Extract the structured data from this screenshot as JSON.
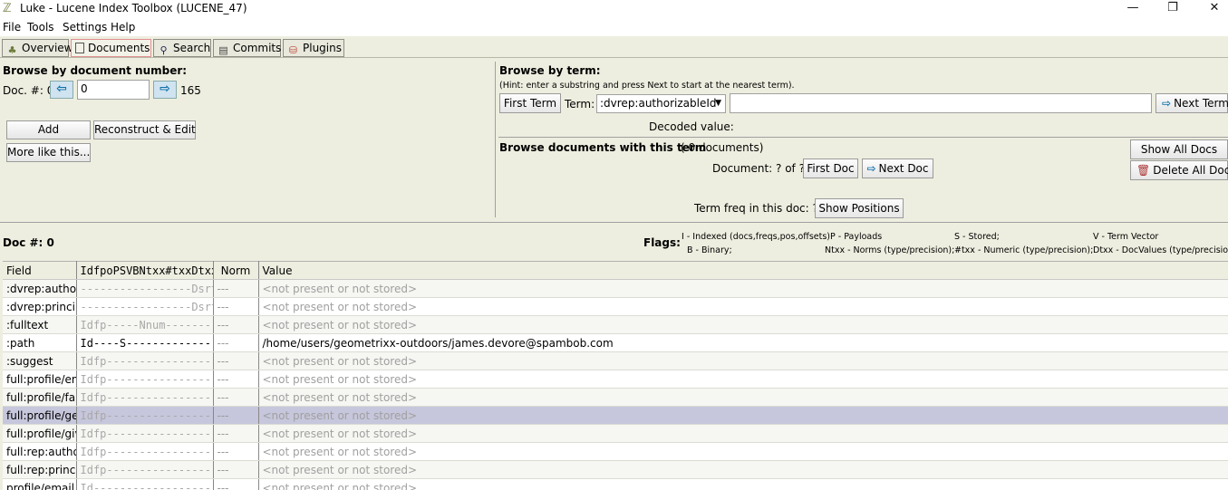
{
  "window": {
    "title": "Luke - Lucene Index Toolbox (LUCENE_47)",
    "min": "—",
    "max": "❐",
    "close": "✕"
  },
  "menu": [
    "File",
    "Tools",
    "Settings",
    "Help"
  ],
  "tabs": [
    {
      "label": "Overview",
      "icon": "tree-icon"
    },
    {
      "label": "Documents",
      "icon": "document-icon"
    },
    {
      "label": "Search",
      "icon": "search-icon"
    },
    {
      "label": "Commits",
      "icon": "commits-icon"
    },
    {
      "label": "Plugins",
      "icon": "plugins-icon"
    }
  ],
  "browse_doc": {
    "heading": "Browse by document number:",
    "doc_label": "Doc. #: 0",
    "doc_value": "0",
    "max_doc": "165",
    "add": "Add",
    "reconstruct": "Reconstruct & Edit",
    "more_like": "More like this..."
  },
  "browse_term": {
    "heading": "Browse by term:",
    "hint": "(Hint: enter a substring and press Next to start at the nearest term).",
    "first_term": "First Term",
    "term_label": "Term:",
    "term_field": ":dvrep:authorizableId",
    "term_value": "",
    "next_term": "Next Term",
    "decoded_label": "Decoded value:"
  },
  "browse_docs_term": {
    "heading": "Browse documents with this term",
    "count": "( 0  documents)",
    "doc_pos": "Document: ?  of  ?",
    "first_doc": "First Doc",
    "next_doc": "Next Doc",
    "show_all": "Show All Docs",
    "delete_all": "Delete All Docs",
    "term_freq": "Term freq in this doc:  ?",
    "show_positions": "Show Positions"
  },
  "doc_info": {
    "label": "Doc #: 0",
    "flags_label": "Flags:",
    "flags": [
      "I - Indexed (docs,freqs,pos,offsets)",
      "P - Payloads",
      "S - Stored;",
      "V - Term Vector",
      "B - Binary;",
      "Ntxx - Norms (type/precision);",
      "#txx - Numeric (type/precision);",
      "Dtxx - DocValues (type/precision)"
    ]
  },
  "table": {
    "headers": [
      "Field",
      "IdfpoPSVBNtxx#txxDtxx",
      "Norm",
      "Value"
    ],
    "rows": [
      {
        "field": ":dvrep:author",
        "flags": "-----------------Dsrt",
        "norm": "---",
        "value": "<not present or not stored>"
      },
      {
        "field": ":dvrep:princip",
        "flags": "-----------------Dsrt",
        "norm": "---",
        "value": "<not present or not stored>"
      },
      {
        "field": ":fulltext",
        "flags": "Idfp-----Nnum--------",
        "norm": "---",
        "value": "<not present or not stored>"
      },
      {
        "field": ":path",
        "flags": "Id----S--------------",
        "norm": "---",
        "value": "/home/users/geometrixx-outdoors/james.devore@spambob.com"
      },
      {
        "field": ":suggest",
        "flags": "Idfp-----------------",
        "norm": "---",
        "value": "<not present or not stored>"
      },
      {
        "field": "full:profile/em",
        "flags": "Idfp-----------------",
        "norm": "---",
        "value": "<not present or not stored>"
      },
      {
        "field": "full:profile/fan",
        "flags": "Idfp-----------------",
        "norm": "---",
        "value": "<not present or not stored>"
      },
      {
        "field": "full:profile/ge",
        "flags": "Idfp-----------------",
        "norm": "---",
        "value": "<not present or not stored>"
      },
      {
        "field": "full:profile/giv",
        "flags": "Idfp-----------------",
        "norm": "---",
        "value": "<not present or not stored>"
      },
      {
        "field": "full:rep:autho",
        "flags": "Idfp-----------------",
        "norm": "---",
        "value": "<not present or not stored>"
      },
      {
        "field": "full:rep:princi",
        "flags": "Idfp-----------------",
        "norm": "---",
        "value": "<not present or not stored>"
      },
      {
        "field": "profile/email",
        "flags": "Id-------------------",
        "norm": "---",
        "value": "<not present or not stored>"
      }
    ]
  }
}
